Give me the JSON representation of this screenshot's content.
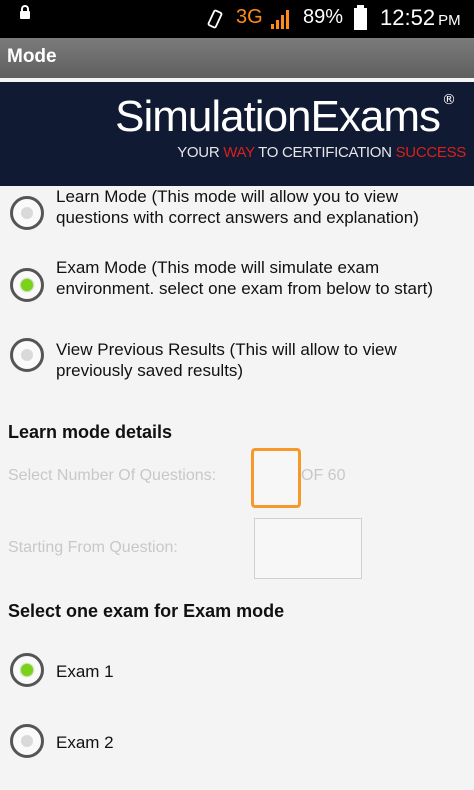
{
  "status_bar": {
    "network": "3G",
    "battery": "89%",
    "time": "12:52",
    "ampm": "PM"
  },
  "title": "Mode",
  "banner": {
    "brand": "SimulationExams",
    "reg": "®",
    "tagline_parts": [
      "YOUR ",
      "WAY",
      " TO CERTIFICATION ",
      "SUCCESS"
    ]
  },
  "modes": [
    {
      "label": "Learn Mode      (This mode will allow you to view questions with correct answers and explanation)",
      "checked": false
    },
    {
      "label": "Exam Mode  (This mode will simulate exam environment. select one exam from below to start)",
      "checked": true
    },
    {
      "label": "View Previous Results    (This will allow to view previously saved results)",
      "checked": false
    }
  ],
  "learn_details": {
    "heading": "Learn mode details",
    "questions_label": "Select Number Of Questions:",
    "questions_value": "",
    "of_total": "OF 60",
    "start_label": "Starting From Question:",
    "start_value": ""
  },
  "exam_section": {
    "heading": "Select one exam for Exam mode",
    "exams": [
      {
        "label": "Exam 1",
        "checked": true
      },
      {
        "label": "Exam 2",
        "checked": false
      }
    ]
  },
  "colors": {
    "accent_orange": "#f59a2a",
    "radio_green": "#7ad319",
    "banner_bg": "#101a33",
    "tag_red": "#d9201c"
  }
}
